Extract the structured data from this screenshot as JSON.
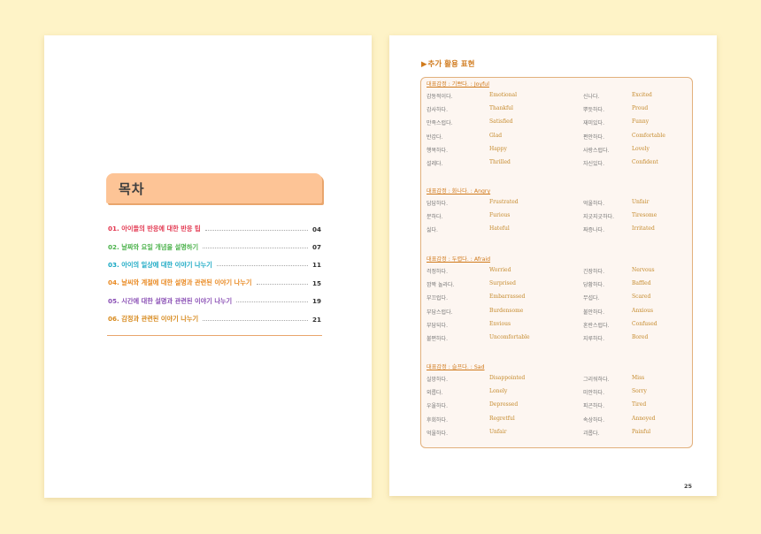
{
  "toc": {
    "heading": "목차",
    "items": [
      {
        "title": "01. 아이들의 반응에 대한 반응 팁",
        "page": "04",
        "color": "#e2364f"
      },
      {
        "title": "02. 날짜와 요일 개념을 설명하기",
        "page": "07",
        "color": "#4bb24b"
      },
      {
        "title": "03. 아이의 일상에 대한 이야기 나누기",
        "page": "11",
        "color": "#1aa9c4"
      },
      {
        "title": "04. 날씨와 계절에 대한 설명과 관련된 이야기 나누기",
        "page": "15",
        "color": "#e98a23"
      },
      {
        "title": "05. 시간에 대한 설명과 관련된 이야기 나누기",
        "page": "19",
        "color": "#8a4fb5"
      },
      {
        "title": "06. 감정과 관련된 이야기 나누기",
        "page": "21",
        "color": "#d78a1e"
      }
    ]
  },
  "expressions": {
    "section_title": "추가 활용 표현",
    "groups": [
      {
        "heading": "대표감정 : 기쁘다. : Joyful",
        "rows": [
          {
            "ko1": "감동적이다.",
            "en1": "Emotional",
            "ko2": "신나다.",
            "en2": "Excited"
          },
          {
            "ko1": "감사하다.",
            "en1": "Thankful",
            "ko2": "뿌듯하다.",
            "en2": "Proud"
          },
          {
            "ko1": "만족스럽다.",
            "en1": "Satisfied",
            "ko2": "재미있다.",
            "en2": "Funny"
          },
          {
            "ko1": "반갑다.",
            "en1": "Glad",
            "ko2": "편안하다.",
            "en2": "Comfortable"
          },
          {
            "ko1": "행복하다.",
            "en1": "Happy",
            "ko2": "사랑스럽다.",
            "en2": "Lovely"
          },
          {
            "ko1": "설레다.",
            "en1": "Thrilled",
            "ko2": "자신있다.",
            "en2": "Confident"
          }
        ]
      },
      {
        "heading": "대표감정 : 화나다. : Angry",
        "rows": [
          {
            "ko1": "답답하다.",
            "en1": "Frustrated",
            "ko2": "억울하다.",
            "en2": "Unfair"
          },
          {
            "ko1": "분하다.",
            "en1": "Furious",
            "ko2": "지긋지긋하다.",
            "en2": "Tiresome"
          },
          {
            "ko1": "싫다.",
            "en1": "Hateful",
            "ko2": "짜증나다.",
            "en2": "Irritated"
          }
        ]
      },
      {
        "heading": "대표감정 : 두렵다. : Afraid",
        "rows": [
          {
            "ko1": "걱정하다.",
            "en1": "Worried",
            "ko2": "긴장하다.",
            "en2": "Nervous"
          },
          {
            "ko1": "깜짝 놀라다.",
            "en1": "Surprised",
            "ko2": "당황하다.",
            "en2": "Baffled"
          },
          {
            "ko1": "부끄럽다.",
            "en1": "Embarrassed",
            "ko2": "무섭다.",
            "en2": "Scared"
          },
          {
            "ko1": "부담스럽다.",
            "en1": "Burdensome",
            "ko2": "불안하다.",
            "en2": "Anxious"
          },
          {
            "ko1": "부담되다.",
            "en1": "Envious",
            "ko2": "혼란스럽다.",
            "en2": "Confused"
          },
          {
            "ko1": "불편하다.",
            "en1": "Uncomfortable",
            "ko2": "지루하다.",
            "en2": "Bored"
          }
        ]
      },
      {
        "heading": "대표감정 : 슬프다. : Sad",
        "rows": [
          {
            "ko1": "실망하다.",
            "en1": "Disappointed",
            "ko2": "그리워하다.",
            "en2": "Miss"
          },
          {
            "ko1": "외롭다.",
            "en1": "Lonely",
            "ko2": "미안하다.",
            "en2": "Sorry"
          },
          {
            "ko1": "우울하다.",
            "en1": "Depressed",
            "ko2": "피곤하다.",
            "en2": "Tired"
          },
          {
            "ko1": "후회하다.",
            "en1": "Regretful",
            "ko2": "속상하다.",
            "en2": "Annoyed"
          },
          {
            "ko1": "억울하다.",
            "en1": "Unfair",
            "ko2": "괴롭다.",
            "en2": "Painful"
          }
        ]
      }
    ],
    "page_number": "25"
  }
}
